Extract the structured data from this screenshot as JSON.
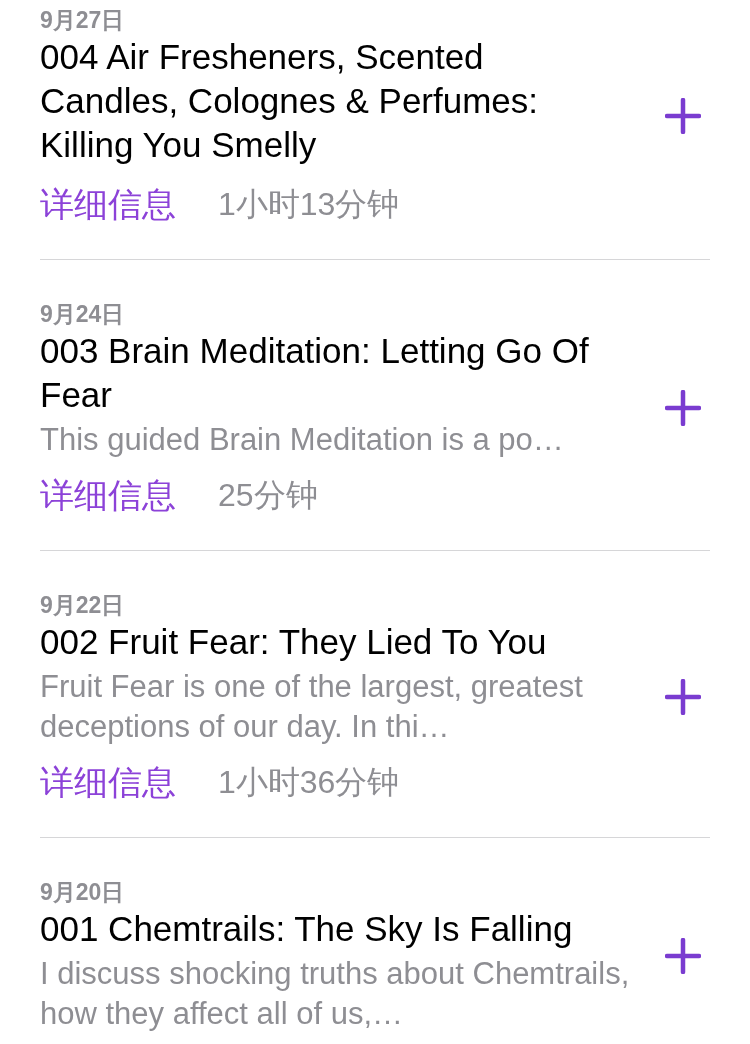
{
  "episodes": [
    {
      "date": "9月27日",
      "title": "004 Air Fresheners, Scented Candles, Colognes & Perfumes: Killing You Smelly",
      "details_link": "详细信息",
      "duration": "1小时13分钟"
    },
    {
      "date": "9月24日",
      "title": "003 Brain Meditation: Letting Go Of Fear",
      "description": "This guided Brain Meditation is a po…",
      "details_link": "详细信息",
      "duration": "25分钟"
    },
    {
      "date": "9月22日",
      "title": "002 Fruit Fear: They Lied To You",
      "description": "Fruit Fear is one of the largest, greatest deceptions of our day. In thi…",
      "details_link": "详细信息",
      "duration": "1小时36分钟"
    },
    {
      "date": "9月20日",
      "title": "001 Chemtrails: The Sky Is Falling",
      "description": "I discuss shocking truths about Chemtrails, how they affect all of us,…"
    }
  ]
}
